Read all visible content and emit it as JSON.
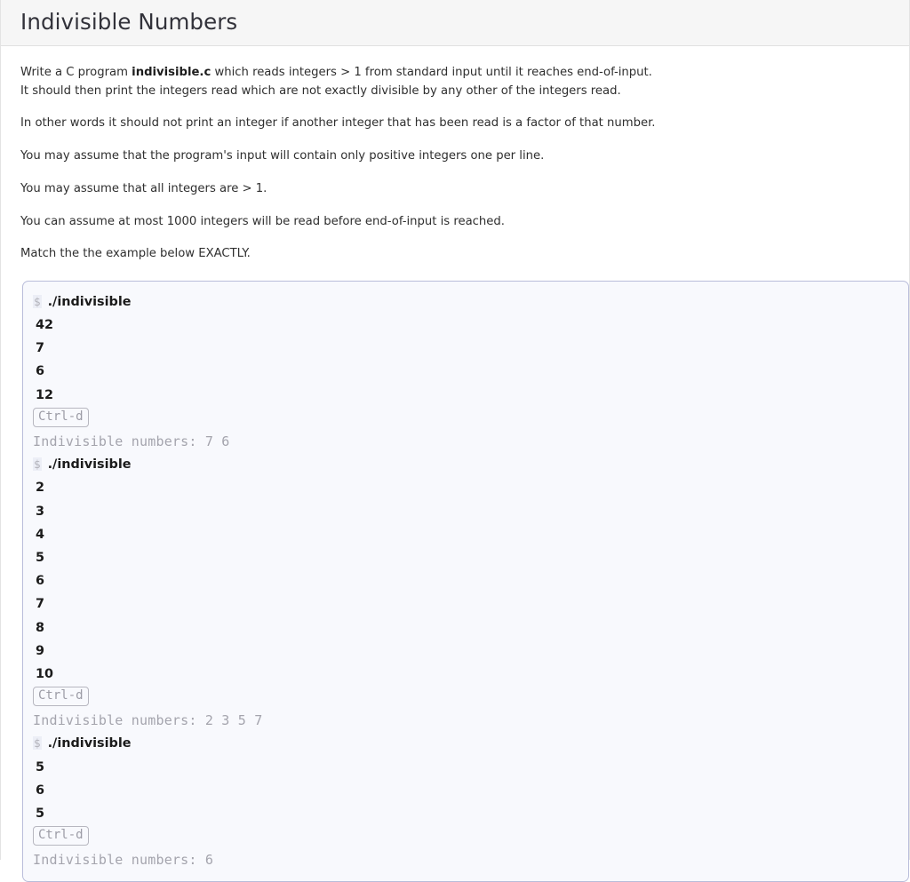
{
  "header": {
    "title": "Indivisible Numbers"
  },
  "description": {
    "paragraphs": [
      {
        "lines": [
          {
            "pre": "Write a C program ",
            "bold": "indivisible.c",
            "post": " which reads integers > 1 from standard input until it reaches end-of-input."
          },
          {
            "pre": "It should then print the integers read which are not exactly divisible by any other of the integers read.",
            "bold": "",
            "post": ""
          }
        ]
      },
      {
        "lines": [
          {
            "pre": "In other words it should not print an integer if another integer that has been read is a factor of that number.",
            "bold": "",
            "post": ""
          }
        ]
      },
      {
        "lines": [
          {
            "pre": "You may assume that the program's input will contain only positive integers one per line.",
            "bold": "",
            "post": ""
          }
        ]
      },
      {
        "lines": [
          {
            "pre": "You may assume that all integers are > 1.",
            "bold": "",
            "post": ""
          }
        ]
      },
      {
        "lines": [
          {
            "pre": "You can assume at most 1000 integers will be read before end-of-input is reached.",
            "bold": "",
            "post": ""
          }
        ]
      },
      {
        "lines": [
          {
            "pre": "Match the the example below EXACTLY.",
            "bold": "",
            "post": ""
          }
        ]
      }
    ]
  },
  "terminal": {
    "prompt_symbol": "$",
    "eof_key_label": "Ctrl-d",
    "sessions": [
      {
        "command": "./indivisible",
        "stdin": [
          "42",
          "7",
          "6",
          "12"
        ],
        "stdout": "Indivisible numbers: 7 6"
      },
      {
        "command": "./indivisible",
        "stdin": [
          "2",
          "3",
          "4",
          "5",
          "6",
          "7",
          "8",
          "9",
          "10"
        ],
        "stdout": "Indivisible numbers: 2 3 5 7"
      },
      {
        "command": "./indivisible",
        "stdin": [
          "5",
          "6",
          "5"
        ],
        "stdout": "Indivisible numbers: 6"
      }
    ]
  },
  "colors": {
    "header_bg": "#f6f6f6",
    "terminal_bg": "#f8f9fd",
    "terminal_border": "#b9bdda",
    "stdout_text": "#a4a4ad",
    "body_text": "#2f2f2f"
  }
}
